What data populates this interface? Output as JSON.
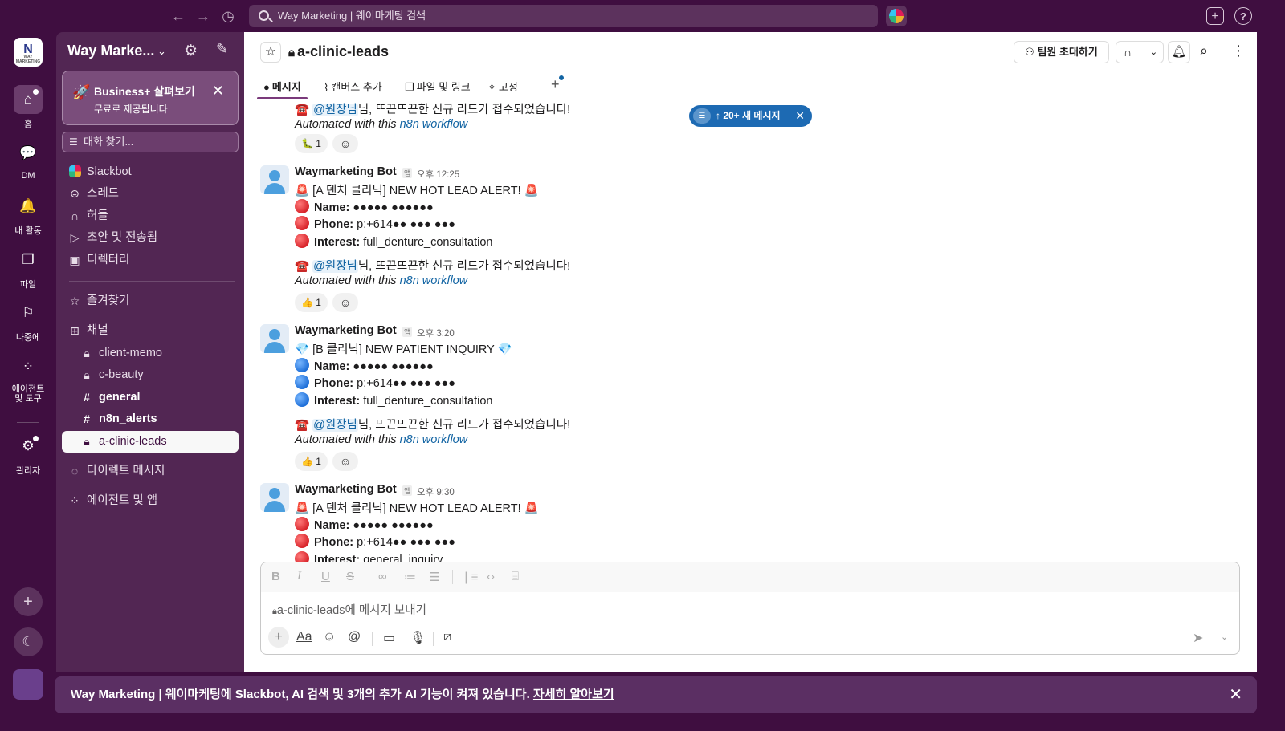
{
  "search": {
    "placeholder": "Way Marketing | 웨이마케팅 검색"
  },
  "workspace": {
    "logo_text": "N",
    "logo_sub": "WAY MARKETING",
    "name": "Way Marke..."
  },
  "rail": [
    {
      "label": "홈"
    },
    {
      "label": "DM"
    },
    {
      "label": "내 활동"
    },
    {
      "label": "파일"
    },
    {
      "label": "나중에"
    },
    {
      "label": "에이전트 및 도구"
    },
    {
      "label": "관리자"
    }
  ],
  "promo": {
    "title": "Business+ 살펴보기",
    "subtitle": "무료로 제공됩니다"
  },
  "find_placeholder": "대화 찾기...",
  "sidebar": {
    "top_items": [
      "Slackbot",
      "스레드",
      "허들",
      "초안 및 전송됨",
      "디렉터리"
    ],
    "favorites": "즐겨찾기",
    "channels_header": "채널",
    "channels": [
      "client-memo",
      "c-beauty",
      "general",
      "n8n_alerts",
      "a-clinic-leads"
    ],
    "dm_header": "다이렉트 메시지",
    "apps_header": "에이전트 및 앱"
  },
  "channel": {
    "name": "a-clinic-leads",
    "invite_label": "팀원 초대하기",
    "tabs": [
      "메시지",
      "캔버스 추가",
      "파일 및 링크",
      "고정"
    ]
  },
  "new_messages": "↑ 20+ 새 메시지",
  "messages": {
    "tail": {
      "mention_line_prefix": "☎️ ",
      "mention": "@원장님",
      "mention_line_suffix": "님, 뜨끈뜨끈한 신규 리드가 접수되었습니다!",
      "automated_prefix": "Automated with this ",
      "automated_link": "n8n workflow",
      "reaction_emoji": "🐛",
      "reaction_count": "1"
    },
    "list": [
      {
        "sender": "Waymarketing Bot",
        "app_tag": "앱",
        "time": "오후 12:25",
        "headline": "🚨 [A 덴처 클리닉] NEW HOT LEAD ALERT! 🚨",
        "name_label": "Name:",
        "name_value": "●●●●● ●●●●●●",
        "phone_label": "Phone:",
        "phone_value": "p:+614●● ●●● ●●●",
        "interest_label": "Interest:",
        "interest_value": "full_denture_consultation",
        "mention": "@원장님",
        "mention_suffix": "님, 뜨끈뜨끈한 신규 리드가 접수되었습니다!",
        "automated_prefix": "Automated with this ",
        "automated_link": "n8n workflow",
        "reaction_emoji": "👍",
        "reaction_count": "1"
      },
      {
        "sender": "Waymarketing Bot",
        "app_tag": "앱",
        "time": "오후 3:20",
        "headline": "💎 [B 클리닉] NEW PATIENT INQUIRY 💎",
        "name_label": "Name:",
        "name_value": "●●●●● ●●●●●●",
        "phone_label": "Phone:",
        "phone_value": "p:+614●● ●●● ●●●",
        "interest_label": "Interest:",
        "interest_value": "full_denture_consultation",
        "mention": "@원장님",
        "mention_suffix": "님, 뜨끈뜨끈한 신규 리드가 접수되었습니다!",
        "automated_prefix": "Automated with this ",
        "automated_link": "n8n workflow",
        "reaction_emoji": "👍",
        "reaction_count": "1"
      },
      {
        "sender": "Waymarketing Bot",
        "app_tag": "앱",
        "time": "오후 9:30",
        "headline": "🚨 [A 덴처 클리닉] NEW HOT LEAD ALERT! 🚨",
        "name_label": "Name:",
        "name_value": "●●●●● ●●●●●●",
        "phone_label": "Phone:",
        "phone_value": "p:+614●● ●●● ●●●",
        "interest_label": "Interest:",
        "interest_value": "general_inquiry"
      }
    ]
  },
  "composer": {
    "placeholder": "a-clinic-leads에 메시지 보내기"
  },
  "banner": {
    "text": "Way Marketing | 웨이마케팅에 Slackbot, AI 검색 및 3개의 추가 AI 기능이 켜져 있습니다. ",
    "link": "자세히 알아보기"
  },
  "colors": {
    "aubergine": "#3f0e40",
    "sidebar": "#522653",
    "link": "#1264a3",
    "new_msg_pill": "#1d6ab3"
  }
}
